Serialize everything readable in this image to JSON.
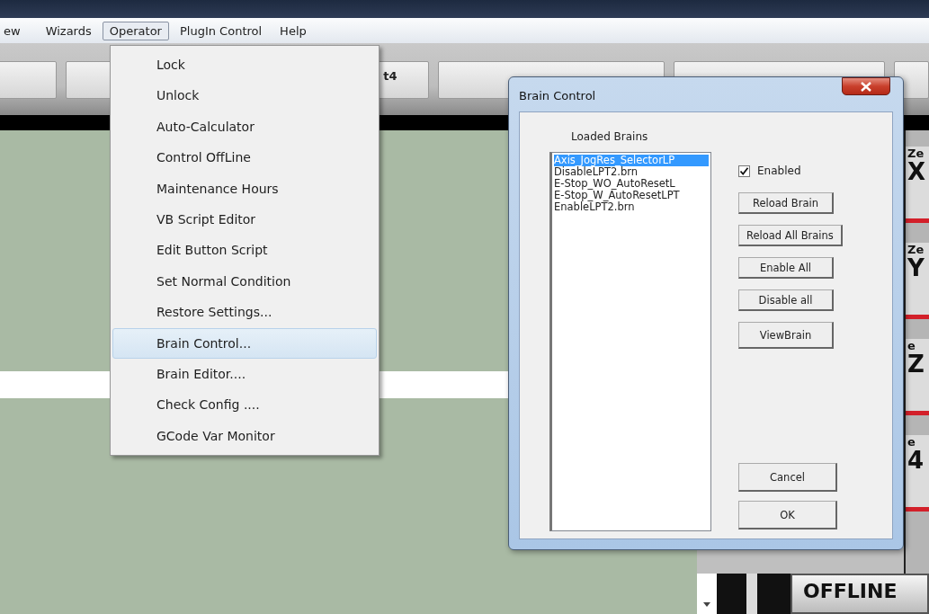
{
  "menubar": [
    {
      "label": "ew",
      "selected": false
    },
    {
      "label": "Wizards",
      "selected": false
    },
    {
      "label": "Operator",
      "selected": true
    },
    {
      "label": "PlugIn Control",
      "selected": false
    },
    {
      "label": "Help",
      "selected": false
    }
  ],
  "toolbar": {
    "button_text": "t4"
  },
  "operator_menu": [
    {
      "label": "Lock",
      "selected": false
    },
    {
      "label": "Unlock",
      "selected": false
    },
    {
      "label": "Auto-Calculator",
      "selected": false
    },
    {
      "label": "Control OffLine",
      "selected": false
    },
    {
      "label": "Maintenance Hours",
      "selected": false
    },
    {
      "label": "VB Script Editor",
      "selected": false
    },
    {
      "label": "Edit Button Script",
      "selected": false
    },
    {
      "label": "Set Normal Condition",
      "selected": false
    },
    {
      "label": "Restore Settings...",
      "selected": false
    },
    {
      "label": "Brain Control...",
      "selected": true
    },
    {
      "label": "Brain Editor....",
      "selected": false
    },
    {
      "label": "Check Config ....",
      "selected": false
    },
    {
      "label": "GCode Var Monitor",
      "selected": false
    }
  ],
  "dialog": {
    "title": "Brain Control",
    "list_label": "Loaded Brains",
    "brains": [
      {
        "name": "Axis_JogRes_SelectorLP",
        "selected": true
      },
      {
        "name": "DisableLPT2.brn",
        "selected": false
      },
      {
        "name": "E-Stop_WO_AutoResetL",
        "selected": false
      },
      {
        "name": "E-Stop_W_AutoResetLPT",
        "selected": false
      },
      {
        "name": "EnableLPT2.brn",
        "selected": false
      }
    ],
    "enabled": {
      "label": "Enabled",
      "checked": true
    },
    "buttons": [
      "Reload Brain",
      "Reload All Brains",
      "Enable All",
      "Disable all",
      "ViewBrain"
    ],
    "footer_buttons": [
      "Cancel",
      "OK"
    ]
  },
  "dro": [
    {
      "label": "Ze",
      "axis": "X"
    },
    {
      "label": "Ze",
      "axis": "Y"
    },
    {
      "label": "e",
      "axis": "Z"
    },
    {
      "label": "e",
      "axis": "4"
    }
  ],
  "offline_button": "OFFLINE"
}
